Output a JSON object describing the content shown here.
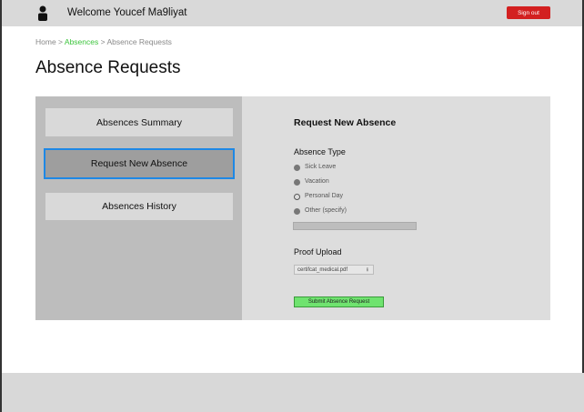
{
  "header": {
    "welcome": "Welcome Youcef Ma9liyat",
    "sign_out": "Sign out",
    "icon": "user-icon"
  },
  "breadcrumb": {
    "home": "Home",
    "sep1": " > ",
    "absences": "Absences",
    "sep2": " > ",
    "current": "Absence Requests"
  },
  "page_title": "Absence Requests",
  "sidebar": {
    "items": [
      {
        "label": "Absences Summary"
      },
      {
        "label": "Request New Absence",
        "selected": true
      },
      {
        "label": "Absences History"
      }
    ]
  },
  "form": {
    "title": "Request New Absence",
    "type_label": "Absence Type",
    "options": [
      {
        "label": "Sick Leave",
        "filled": true
      },
      {
        "label": "Vacation",
        "filled": true
      },
      {
        "label": "Personal Day",
        "filled": false
      },
      {
        "label": "Other (specify)",
        "filled": true
      }
    ],
    "other_value": "",
    "proof_label": "Proof Upload",
    "file_name": "certifcat_medical.pdf",
    "upload_icon": "upload-icon",
    "submit": "Submit Absence Request"
  },
  "colors": {
    "accent": "#1e88e5",
    "sign_out": "#d32020",
    "submit": "#6fe36f",
    "link": "#3cc43c"
  }
}
